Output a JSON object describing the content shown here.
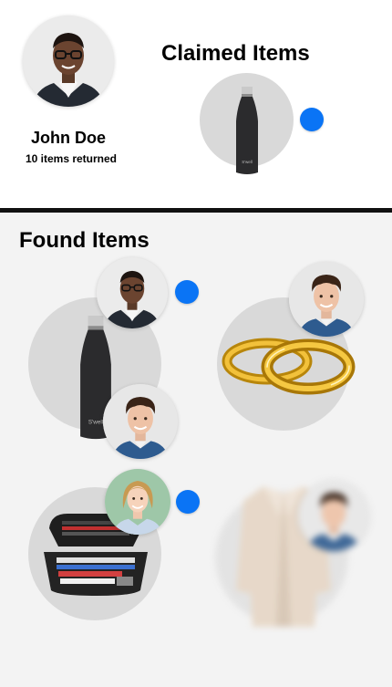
{
  "profile": {
    "name": "John Doe",
    "items_returned": "10 items returned"
  },
  "claimed": {
    "title": "Claimed Items",
    "items": [
      {
        "item": "bottle-icon",
        "bottle_brand": "S'well",
        "has_notification": true
      }
    ]
  },
  "found": {
    "title": "Found Items",
    "items": [
      {
        "item": "bottle-icon",
        "bottle_brand": "S'well",
        "claimants": 2,
        "has_notification": true
      },
      {
        "item": "rings-icon",
        "claimants": 1,
        "has_notification": false
      },
      {
        "item": "pencil-case-icon",
        "claimants": 1,
        "has_notification": true
      },
      {
        "item": "coat-icon",
        "claimants": 1,
        "has_notification": false,
        "state": "blurred"
      }
    ]
  },
  "colors": {
    "accent_blue": "#0a74f5",
    "circle_gray": "#d9d9d9",
    "background_top": "#ffffff",
    "background_bottom": "#f3f3f3",
    "divider": "#111111"
  }
}
